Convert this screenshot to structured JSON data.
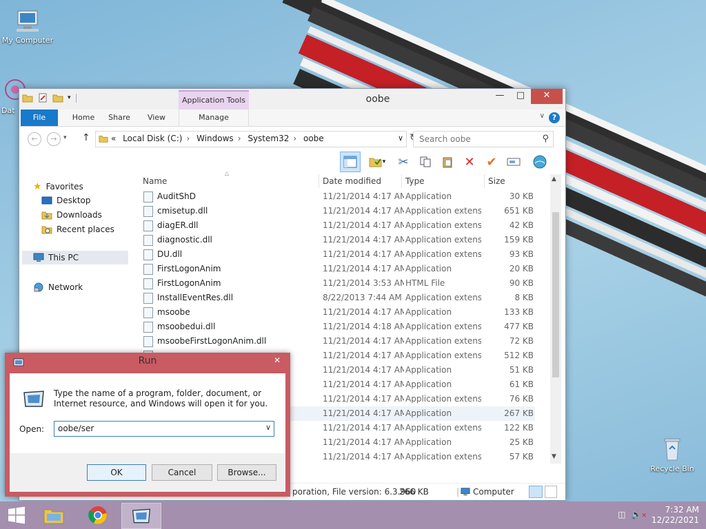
{
  "desktop": {
    "icons": [
      {
        "label": "My Computer"
      },
      {
        "label": "Dat"
      },
      {
        "label": "Recycle Bin"
      }
    ]
  },
  "explorer": {
    "title": "oobe",
    "contextual_tab": "Application Tools",
    "ribbon_tabs": {
      "file": "File",
      "home": "Home",
      "share": "Share",
      "view": "View",
      "manage": "Manage"
    },
    "breadcrumbs": [
      "«",
      "Local Disk (C:)",
      "Windows",
      "System32",
      "oobe"
    ],
    "search_placeholder": "Search oobe",
    "nav": {
      "favorites": "Favorites",
      "desktop": "Desktop",
      "downloads": "Downloads",
      "recent": "Recent places",
      "thispc": "This PC",
      "network": "Network"
    },
    "columns": {
      "name": "Name",
      "date": "Date modified",
      "type": "Type",
      "size": "Size"
    },
    "files": [
      {
        "name": "AuditShD",
        "date": "11/21/2014 4:17 AM",
        "type": "Application",
        "size": "30 KB"
      },
      {
        "name": "cmisetup.dll",
        "date": "11/21/2014 4:17 AM",
        "type": "Application extens...",
        "size": "651 KB"
      },
      {
        "name": "diagER.dll",
        "date": "11/21/2014 4:17 AM",
        "type": "Application extens...",
        "size": "42 KB"
      },
      {
        "name": "diagnostic.dll",
        "date": "11/21/2014 4:17 AM",
        "type": "Application extens...",
        "size": "159 KB"
      },
      {
        "name": "DU.dll",
        "date": "11/21/2014 4:17 AM",
        "type": "Application extens...",
        "size": "93 KB"
      },
      {
        "name": "FirstLogonAnim",
        "date": "11/21/2014 4:17 AM",
        "type": "Application",
        "size": "20 KB"
      },
      {
        "name": "FirstLogonAnim",
        "date": "11/21/2014 3:53 AM",
        "type": "HTML File",
        "size": "90 KB"
      },
      {
        "name": "InstallEventRes.dll",
        "date": "8/22/2013 7:44 AM",
        "type": "Application extens...",
        "size": "8 KB"
      },
      {
        "name": "msoobe",
        "date": "11/21/2014 4:17 AM",
        "type": "Application",
        "size": "133 KB"
      },
      {
        "name": "msoobedui.dll",
        "date": "11/21/2014 4:18 AM",
        "type": "Application extens...",
        "size": "477 KB"
      },
      {
        "name": "msoobeFirstLogonAnim.dll",
        "date": "11/21/2014 4:17 AM",
        "type": "Application extens...",
        "size": "72 KB"
      },
      {
        "name": "",
        "date": "11/21/2014 4:17 AM",
        "type": "Application extens...",
        "size": "512 KB"
      },
      {
        "name": "",
        "date": "11/21/2014 4:17 AM",
        "type": "Application",
        "size": "51 KB"
      },
      {
        "name": "",
        "date": "11/21/2014 4:17 AM",
        "type": "Application",
        "size": "61 KB"
      },
      {
        "name": "",
        "date": "11/21/2014 4:17 AM",
        "type": "Application extens...",
        "size": "76 KB"
      },
      {
        "name": "",
        "date": "11/21/2014 4:17 AM",
        "type": "Application",
        "size": "267 KB"
      },
      {
        "name": "",
        "date": "11/21/2014 4:17 AM",
        "type": "Application extens...",
        "size": "122 KB"
      },
      {
        "name": "",
        "date": "11/21/2014 4:17 AM",
        "type": "Application",
        "size": "25 KB"
      },
      {
        "name": "",
        "date": "11/21/2014 4:17 AM",
        "type": "Application extens...",
        "size": "57 KB"
      }
    ],
    "status": {
      "details": "poration, File version: 6.3.960",
      "size": "266 KB",
      "location": "Computer"
    }
  },
  "run": {
    "title": "Run",
    "close": "✕",
    "description": "Type the name of a program, folder, document, or Internet resource, and Windows will open it for you.",
    "open_label": "Open:",
    "open_value": "oobe/ser",
    "ok": "OK",
    "cancel": "Cancel",
    "browse": "Browse..."
  },
  "taskbar": {
    "time": "7:32 AM",
    "date": "12/22/2021"
  },
  "colors": {
    "accent": "#1979ca",
    "run_frame": "#c95b62",
    "taskbar": "#a48fae"
  }
}
